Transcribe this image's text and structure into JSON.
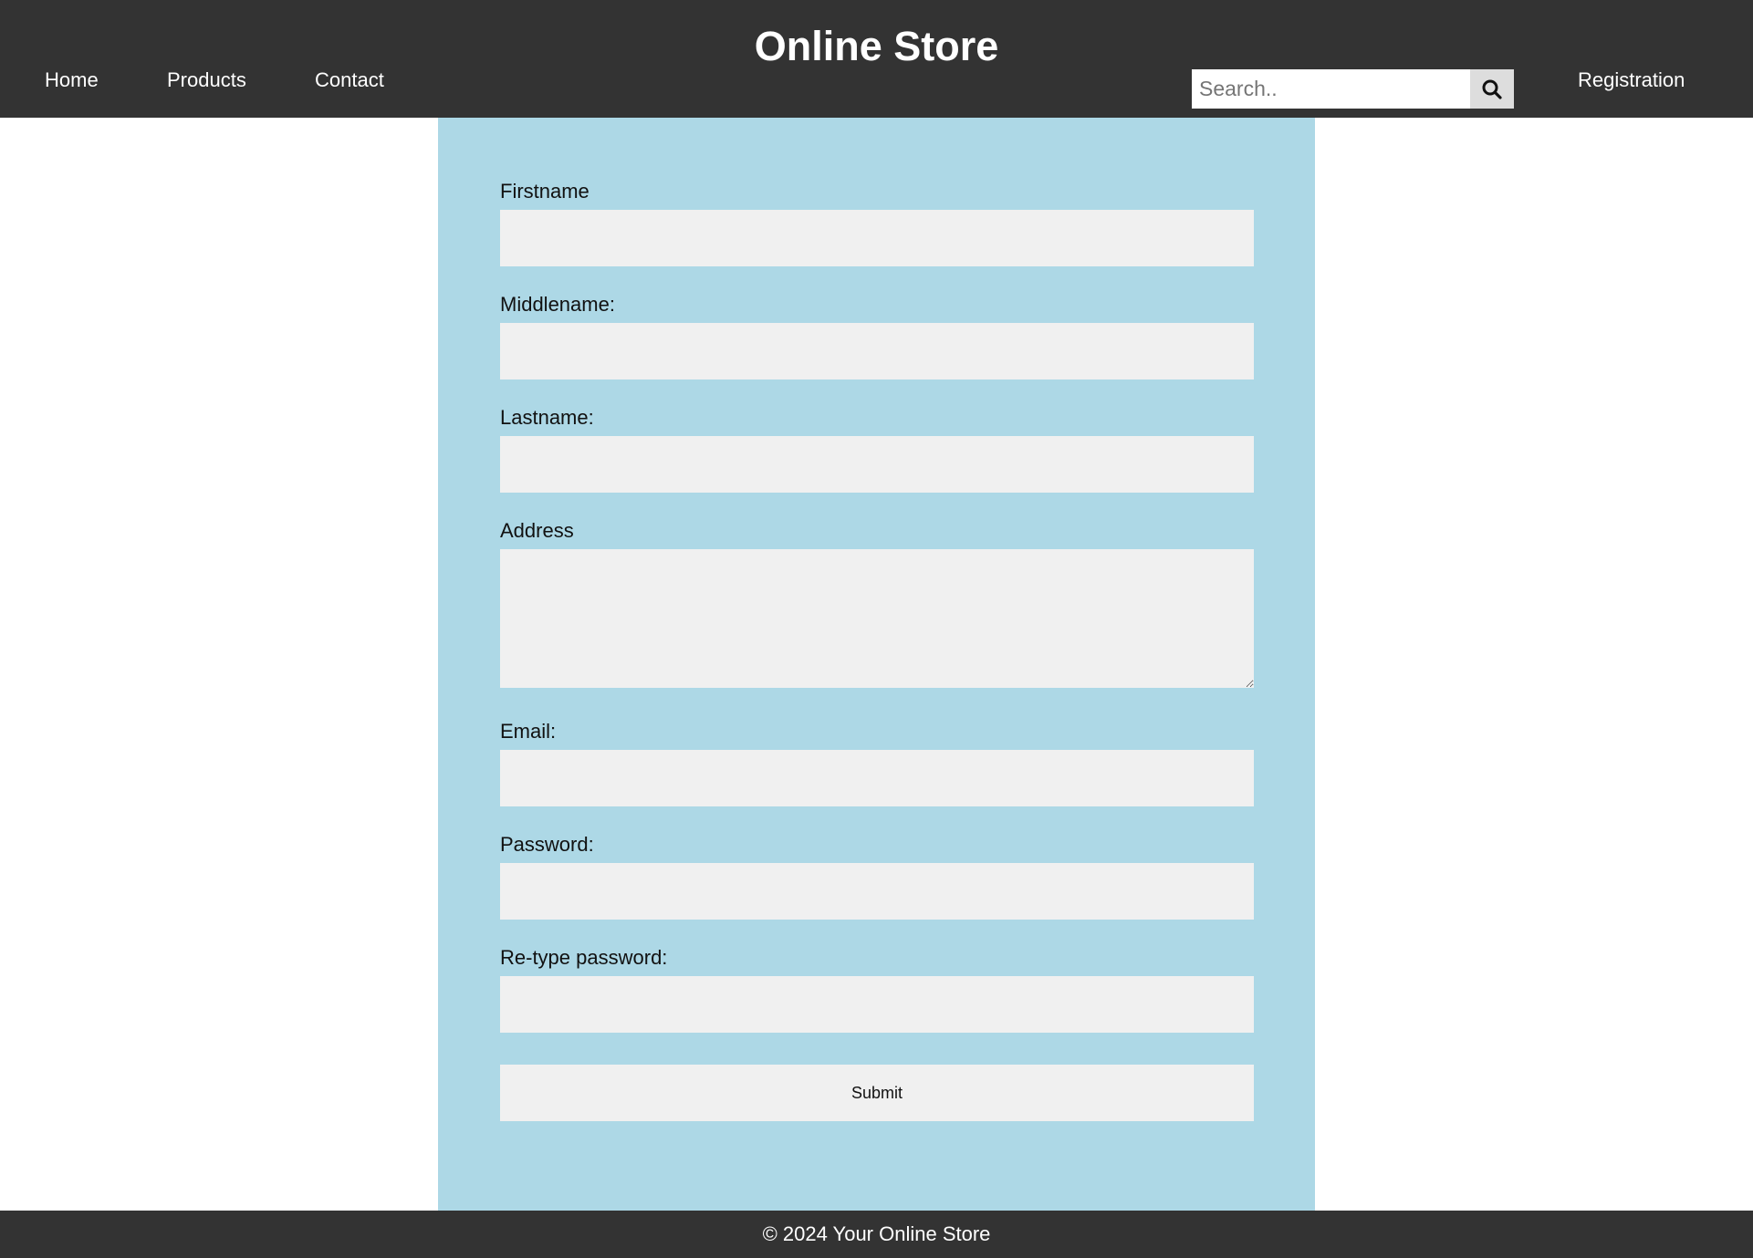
{
  "header": {
    "title": "Online Store",
    "nav": {
      "home": "Home",
      "products": "Products",
      "contact": "Contact",
      "registration": "Registration"
    },
    "search": {
      "placeholder": "Search..",
      "value": "",
      "button_icon": "search-icon"
    }
  },
  "form": {
    "firstname_label": "Firstname",
    "middlename_label": "Middlename:",
    "lastname_label": "Lastname:",
    "address_label": "Address",
    "email_label": "Email:",
    "password_label": "Password:",
    "retype_password_label": "Re-type password:",
    "submit_label": "Submit"
  },
  "footer": {
    "text": "© 2024 Your Online Store"
  },
  "colors": {
    "header_bg": "#333333",
    "panel_bg": "#add8e6",
    "input_bg": "#f0f0f0",
    "search_button_bg": "#dddddd"
  }
}
